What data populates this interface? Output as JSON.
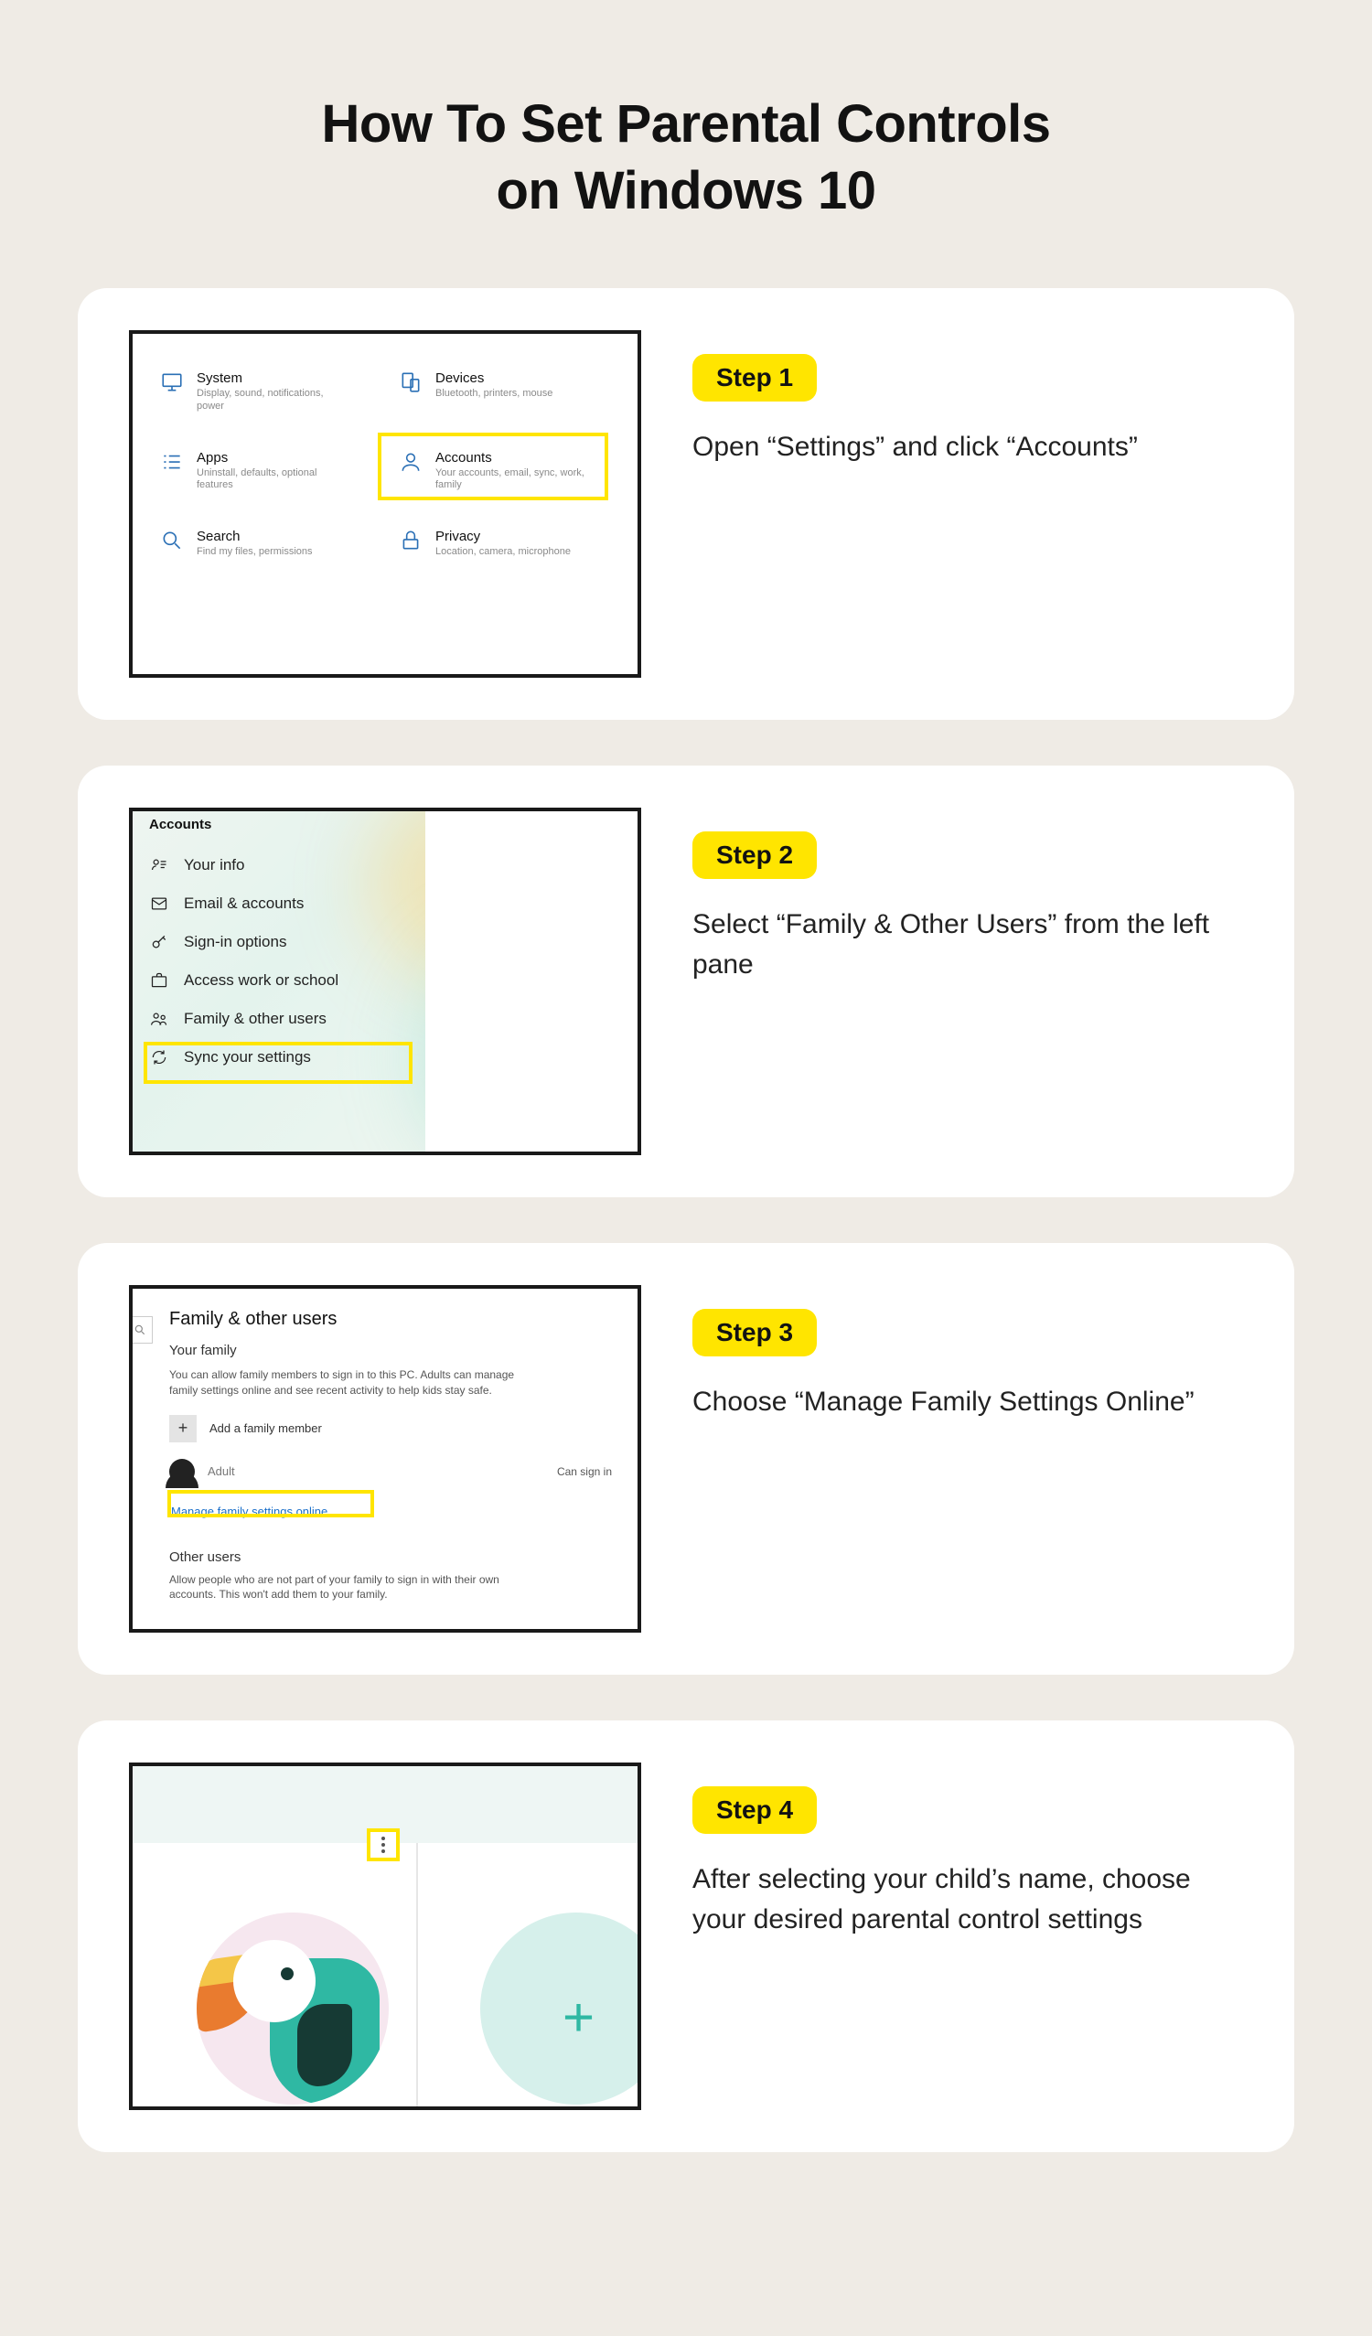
{
  "title_line1": "How To Set Parental Controls",
  "title_line2": "on Windows 10",
  "steps": [
    {
      "badge": "Step 1",
      "desc": "Open “Settings” and click “Accounts”"
    },
    {
      "badge": "Step 2",
      "desc": "Select “Family & Other Users” from the left pane"
    },
    {
      "badge": "Step 3",
      "desc": "Choose “Manage Family Settings Online”"
    },
    {
      "badge": "Step 4",
      "desc": "After selecting your child’s name, choose your desired parental control settings"
    }
  ],
  "shot1": {
    "items": [
      {
        "title": "System",
        "sub": "Display, sound, notifications, power"
      },
      {
        "title": "Devices",
        "sub": "Bluetooth, printers, mouse"
      },
      {
        "title": "Apps",
        "sub": "Uninstall, defaults, optional features"
      },
      {
        "title": "Accounts",
        "sub": "Your accounts, email, sync, work, family"
      },
      {
        "title": "Search",
        "sub": "Find my files, permissions"
      },
      {
        "title": "Privacy",
        "sub": "Location, camera, microphone"
      }
    ]
  },
  "shot2": {
    "header": "Accounts",
    "nav": [
      "Your info",
      "Email & accounts",
      "Sign-in options",
      "Access work or school",
      "Family & other users",
      "Sync your settings"
    ]
  },
  "shot3": {
    "heading": "Family & other users",
    "your_family": "Your family",
    "family_body": "You can allow family members to sign in to this PC. Adults can manage family settings online and see recent activity to help kids stay safe.",
    "add_member": "Add a family member",
    "adult": "Adult",
    "can_sign_in": "Can sign in",
    "manage_link": "Manage family settings online",
    "other_users": "Other users",
    "other_body": "Allow people who are not part of your family to sign in with their own accounts. This won't add them to your family."
  }
}
